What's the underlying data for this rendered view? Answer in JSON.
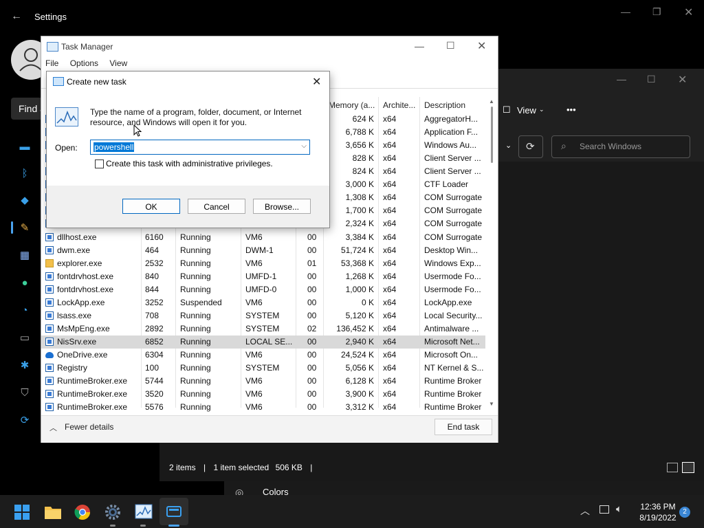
{
  "settings": {
    "title": "Settings",
    "find_placeholder": "Find a"
  },
  "explorer": {
    "view_label": "View",
    "more_label": "•••",
    "search_placeholder": "Search Windows",
    "status_items": "2 items",
    "status_selected": "1 item selected",
    "status_size": "506 KB",
    "colors_label": "Colors"
  },
  "task_manager": {
    "title": "Task Manager",
    "menu": [
      "File",
      "Options",
      "View"
    ],
    "columns": {
      "memory": "Memory (a...",
      "architecture": "Archite...",
      "description": "Description"
    },
    "upper_rows": [
      {
        "memory": "624 K",
        "arch": "x64",
        "desc": "AggregatorH..."
      },
      {
        "memory": "6,788 K",
        "arch": "x64",
        "desc": "Application F..."
      },
      {
        "memory": "3,656 K",
        "arch": "x64",
        "desc": "Windows Au..."
      },
      {
        "memory": "828 K",
        "arch": "x64",
        "desc": "Client Server ..."
      },
      {
        "memory": "824 K",
        "arch": "x64",
        "desc": "Client Server ..."
      },
      {
        "memory": "3,000 K",
        "arch": "x64",
        "desc": "CTF Loader"
      },
      {
        "memory": "1,308 K",
        "arch": "x64",
        "desc": "COM Surrogate"
      },
      {
        "memory": "1,700 K",
        "arch": "x64",
        "desc": "COM Surrogate"
      },
      {
        "memory": "2,324 K",
        "arch": "x64",
        "desc": "COM Surrogate"
      }
    ],
    "rows": [
      {
        "name": "dllhost.exe",
        "pid": "6160",
        "status": "Running",
        "user": "VM6",
        "cpu": "00",
        "memory": "3,384 K",
        "arch": "x64",
        "desc": "COM Surrogate",
        "icon": "app"
      },
      {
        "name": "dwm.exe",
        "pid": "464",
        "status": "Running",
        "user": "DWM-1",
        "cpu": "00",
        "memory": "51,724 K",
        "arch": "x64",
        "desc": "Desktop Win...",
        "icon": "app"
      },
      {
        "name": "explorer.exe",
        "pid": "2532",
        "status": "Running",
        "user": "VM6",
        "cpu": "01",
        "memory": "53,368 K",
        "arch": "x64",
        "desc": "Windows Exp...",
        "icon": "folder"
      },
      {
        "name": "fontdrvhost.exe",
        "pid": "840",
        "status": "Running",
        "user": "UMFD-1",
        "cpu": "00",
        "memory": "1,268 K",
        "arch": "x64",
        "desc": "Usermode Fo...",
        "icon": "app"
      },
      {
        "name": "fontdrvhost.exe",
        "pid": "844",
        "status": "Running",
        "user": "UMFD-0",
        "cpu": "00",
        "memory": "1,000 K",
        "arch": "x64",
        "desc": "Usermode Fo...",
        "icon": "app"
      },
      {
        "name": "LockApp.exe",
        "pid": "3252",
        "status": "Suspended",
        "user": "VM6",
        "cpu": "00",
        "memory": "0 K",
        "arch": "x64",
        "desc": "LockApp.exe",
        "icon": "app"
      },
      {
        "name": "lsass.exe",
        "pid": "708",
        "status": "Running",
        "user": "SYSTEM",
        "cpu": "00",
        "memory": "5,120 K",
        "arch": "x64",
        "desc": "Local Security...",
        "icon": "app"
      },
      {
        "name": "MsMpEng.exe",
        "pid": "2892",
        "status": "Running",
        "user": "SYSTEM",
        "cpu": "02",
        "memory": "136,452 K",
        "arch": "x64",
        "desc": "Antimalware ...",
        "icon": "app"
      },
      {
        "name": "NisSrv.exe",
        "pid": "6852",
        "status": "Running",
        "user": "LOCAL SE...",
        "cpu": "00",
        "memory": "2,940 K",
        "arch": "x64",
        "desc": "Microsoft Net...",
        "icon": "app",
        "selected": true
      },
      {
        "name": "OneDrive.exe",
        "pid": "6304",
        "status": "Running",
        "user": "VM6",
        "cpu": "00",
        "memory": "24,524 K",
        "arch": "x64",
        "desc": "Microsoft On...",
        "icon": "cloud"
      },
      {
        "name": "Registry",
        "pid": "100",
        "status": "Running",
        "user": "SYSTEM",
        "cpu": "00",
        "memory": "5,056 K",
        "arch": "x64",
        "desc": "NT Kernel & S...",
        "icon": "app"
      },
      {
        "name": "RuntimeBroker.exe",
        "pid": "5744",
        "status": "Running",
        "user": "VM6",
        "cpu": "00",
        "memory": "6,128 K",
        "arch": "x64",
        "desc": "Runtime Broker",
        "icon": "app"
      },
      {
        "name": "RuntimeBroker.exe",
        "pid": "3520",
        "status": "Running",
        "user": "VM6",
        "cpu": "00",
        "memory": "3,900 K",
        "arch": "x64",
        "desc": "Runtime Broker",
        "icon": "app"
      },
      {
        "name": "RuntimeBroker.exe",
        "pid": "5576",
        "status": "Running",
        "user": "VM6",
        "cpu": "00",
        "memory": "3,312 K",
        "arch": "x64",
        "desc": "Runtime Broker",
        "icon": "app"
      }
    ],
    "fewer_details": "Fewer details",
    "end_task": "End task"
  },
  "dialog": {
    "title": "Create new task",
    "description": "Type the name of a program, folder, document, or Internet resource, and Windows will open it for you.",
    "open_label": "Open:",
    "open_value": "powershell",
    "admin_label": "Create this task with administrative privileges.",
    "ok": "OK",
    "cancel": "Cancel",
    "browse": "Browse..."
  },
  "taskbar": {
    "time": "12:36 PM",
    "date": "8/19/2022",
    "notification_count": "2"
  },
  "colors": {
    "accent": "#0067c0",
    "selection": "#0078d7"
  }
}
